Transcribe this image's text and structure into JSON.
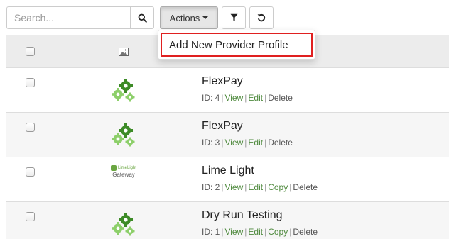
{
  "toolbar": {
    "search_placeholder": "Search...",
    "actions_label": "Actions"
  },
  "dropdown": {
    "items": [
      {
        "label": "Add New Provider Profile"
      }
    ]
  },
  "rows": [
    {
      "name": "FlexPay",
      "id_text": "ID: 4",
      "links": [
        "View",
        "Edit",
        "Delete"
      ],
      "logo": "gears-icon"
    },
    {
      "name": "FlexPay",
      "id_text": "ID: 3",
      "links": [
        "View",
        "Edit",
        "Delete"
      ],
      "logo": "gears-icon"
    },
    {
      "name": "Lime Light",
      "id_text": "ID: 2",
      "links": [
        "View",
        "Edit",
        "Copy",
        "Delete"
      ],
      "logo": "limelight-gateway-logo",
      "logo_text": {
        "brand": "LimeLight",
        "word": "Gateway"
      }
    },
    {
      "name": "Dry Run Testing",
      "id_text": "ID: 1",
      "links": [
        "View",
        "Edit",
        "Copy",
        "Delete"
      ],
      "logo": "gears-icon"
    }
  ],
  "colors": {
    "accent_link": "#4f8a3e",
    "highlight_border": "#e02020",
    "gear_green": "#3d8b27"
  }
}
